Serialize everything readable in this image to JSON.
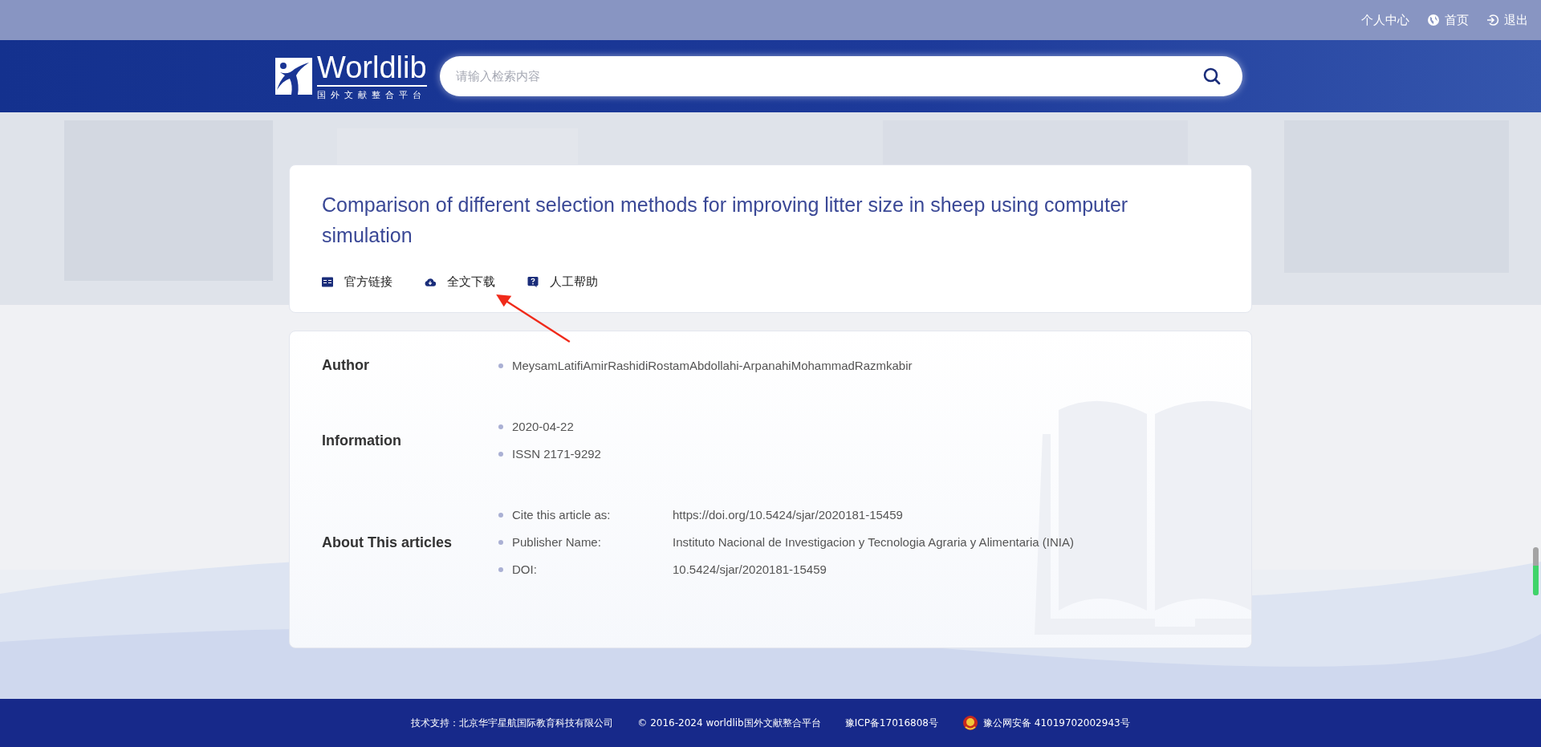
{
  "top_links": [
    {
      "label": "个人中心"
    },
    {
      "label": "首页"
    },
    {
      "label": "退出"
    }
  ],
  "logo": {
    "name": "Worldlib",
    "subtitle": "国外文献整合平台"
  },
  "search": {
    "placeholder": "请输入检索内容"
  },
  "article": {
    "title": "Comparison of different selection methods for improving litter size in sheep using computer simulation",
    "actions": [
      {
        "label": "官方链接"
      },
      {
        "label": "全文下载"
      },
      {
        "label": "人工帮助"
      }
    ]
  },
  "details": [
    {
      "label": "Author",
      "items": [
        {
          "value": "MeysamLatifiAmirRashidiRostamAbdollahi-ArpanahiMohammadRazmkabir"
        }
      ]
    },
    {
      "label": "Information",
      "items": [
        {
          "value": "2020-04-22"
        },
        {
          "value": "ISSN 2171-9292"
        }
      ]
    },
    {
      "label": "About This articles",
      "items": [
        {
          "key": "Cite this article as:",
          "value": "https://doi.org/10.5424/sjar/2020181-15459"
        },
        {
          "key": "Publisher Name:",
          "value": "Instituto Nacional de Investigacion y Tecnologia Agraria y Alimentaria (INIA)"
        },
        {
          "key": "DOI:",
          "value": "10.5424/sjar/2020181-15459"
        }
      ]
    }
  ],
  "footer": [
    "技术支持：北京华宇星航国际教育科技有限公司",
    "© 2016-2024 worldlib国外文献整合平台",
    "豫ICP备17016808号",
    "豫公网安备 41019702002943号"
  ]
}
